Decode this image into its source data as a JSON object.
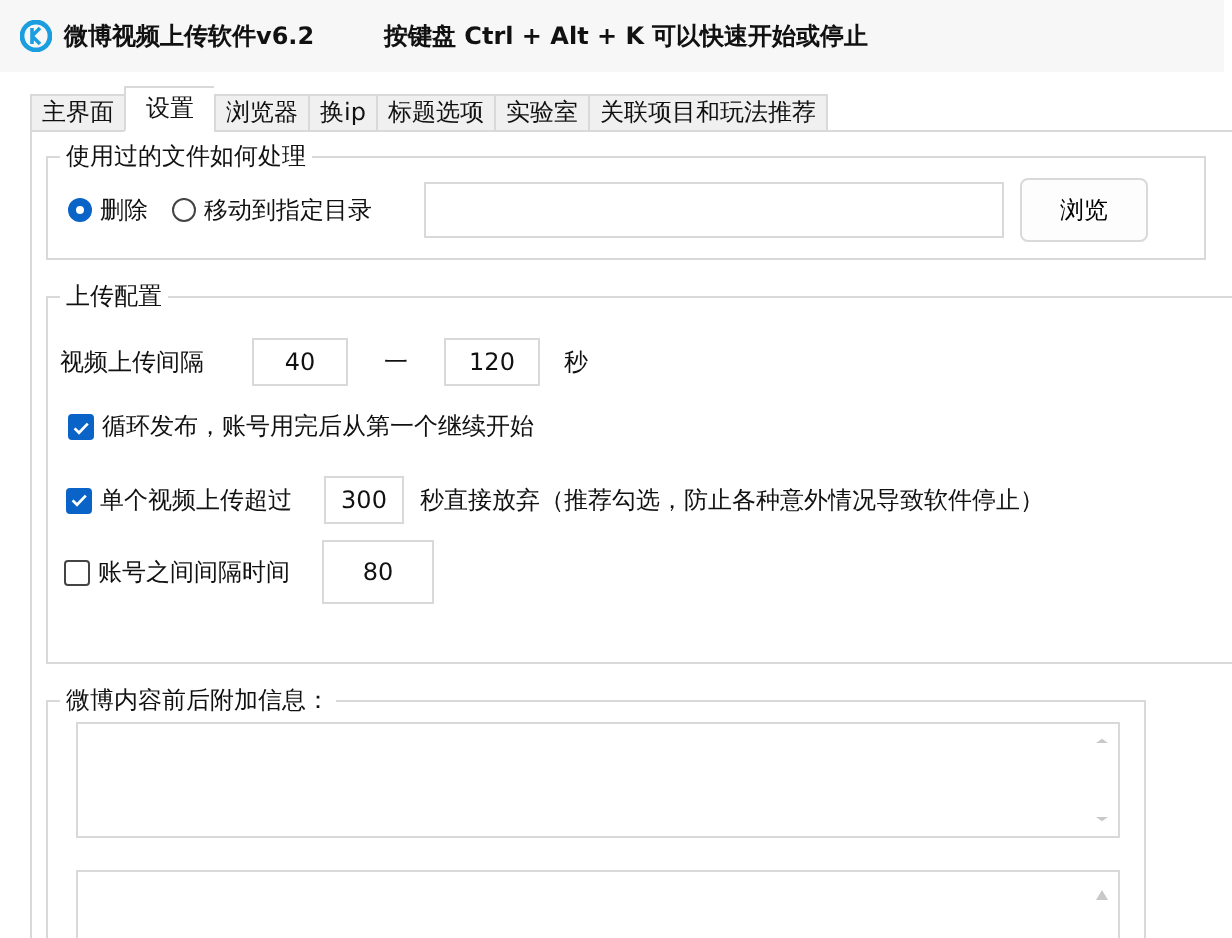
{
  "window": {
    "title": "微博视频上传软件v6.2",
    "hint": "按键盘 Ctrl + Alt + K  可以快速开始或停止"
  },
  "tabs": [
    {
      "label": "主界面",
      "selected": false
    },
    {
      "label": "设置",
      "selected": true
    },
    {
      "label": "浏览器",
      "selected": false
    },
    {
      "label": "换ip",
      "selected": false
    },
    {
      "label": "标题选项",
      "selected": false
    },
    {
      "label": "实验室",
      "selected": false
    },
    {
      "label": "关联项目和玩法推荐",
      "selected": false
    }
  ],
  "file_handling": {
    "title": "使用过的文件如何处理",
    "options": [
      {
        "label": "删除",
        "selected": true
      },
      {
        "label": "移动到指定目录",
        "selected": false
      }
    ],
    "browse_button": "浏览"
  },
  "upload_config": {
    "title": "上传配置",
    "interval_label": "视频上传间隔",
    "interval_min": "40",
    "separator": "一",
    "interval_max": "120",
    "unit": "秒",
    "options": [
      {
        "kind": "checkbox",
        "label": "循环发布，账号用完后从第一个继续开始",
        "checked": true
      },
      {
        "kind": "checkbox_input",
        "label": "单个视频上传超过",
        "checked": true,
        "value": "300",
        "suffix": "秒直接放弃（推荐勾选，防止各种意外情况导致软件停止）"
      },
      {
        "kind": "checkbox_input",
        "label": "账号之间间隔时间",
        "checked": false,
        "value": "80"
      }
    ]
  },
  "extra_info": {
    "title": "微博内容前后附加信息："
  }
}
